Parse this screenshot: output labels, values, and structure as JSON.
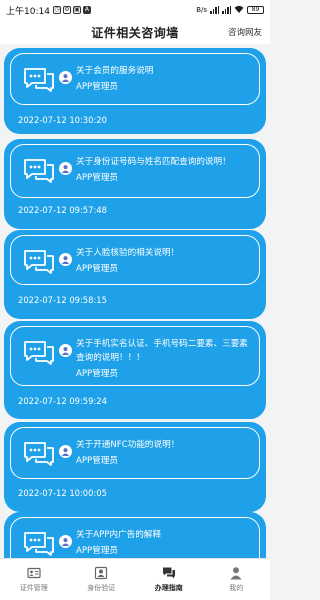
{
  "status_bar": {
    "time": "上午10:14",
    "network_speed": "B/s",
    "battery": "89"
  },
  "header": {
    "title": "证件相关咨询墙",
    "right_link": "咨询网友"
  },
  "messages": [
    {
      "title": "关于会员的服务说明",
      "author": "APP管理员",
      "date": "2022-07-12 10:30:20"
    },
    {
      "title": "关于身份证号码与姓名匹配查询的说明！",
      "author": "APP管理员",
      "date": "2022-07-12 09:57:48"
    },
    {
      "title": "关于人脸核验的相关说明！",
      "author": "APP管理员",
      "date": "2022-07-12 09:58:15"
    },
    {
      "title": "关于手机实名认证、手机号码二要素、三要素查询的说明！！！",
      "author": "APP管理员",
      "date": "2022-07-12 09:59:24"
    },
    {
      "title": "关于开通NFC功能的说明！",
      "author": "APP管理员",
      "date": "2022-07-12 10:00:05"
    },
    {
      "title": "关于APP内广告的解释",
      "author": "APP管理员",
      "date": ""
    }
  ],
  "tabs": [
    {
      "label": "证件管理",
      "icon": "id-card-icon"
    },
    {
      "label": "身份验证",
      "icon": "verify-icon"
    },
    {
      "label": "办理指南",
      "icon": "chat-bubbles-icon"
    },
    {
      "label": "我的",
      "icon": "person-icon"
    }
  ],
  "colors": {
    "card": "#1ea1e8",
    "background": "#f2f3f5",
    "text_on_card": "#ffffff"
  }
}
